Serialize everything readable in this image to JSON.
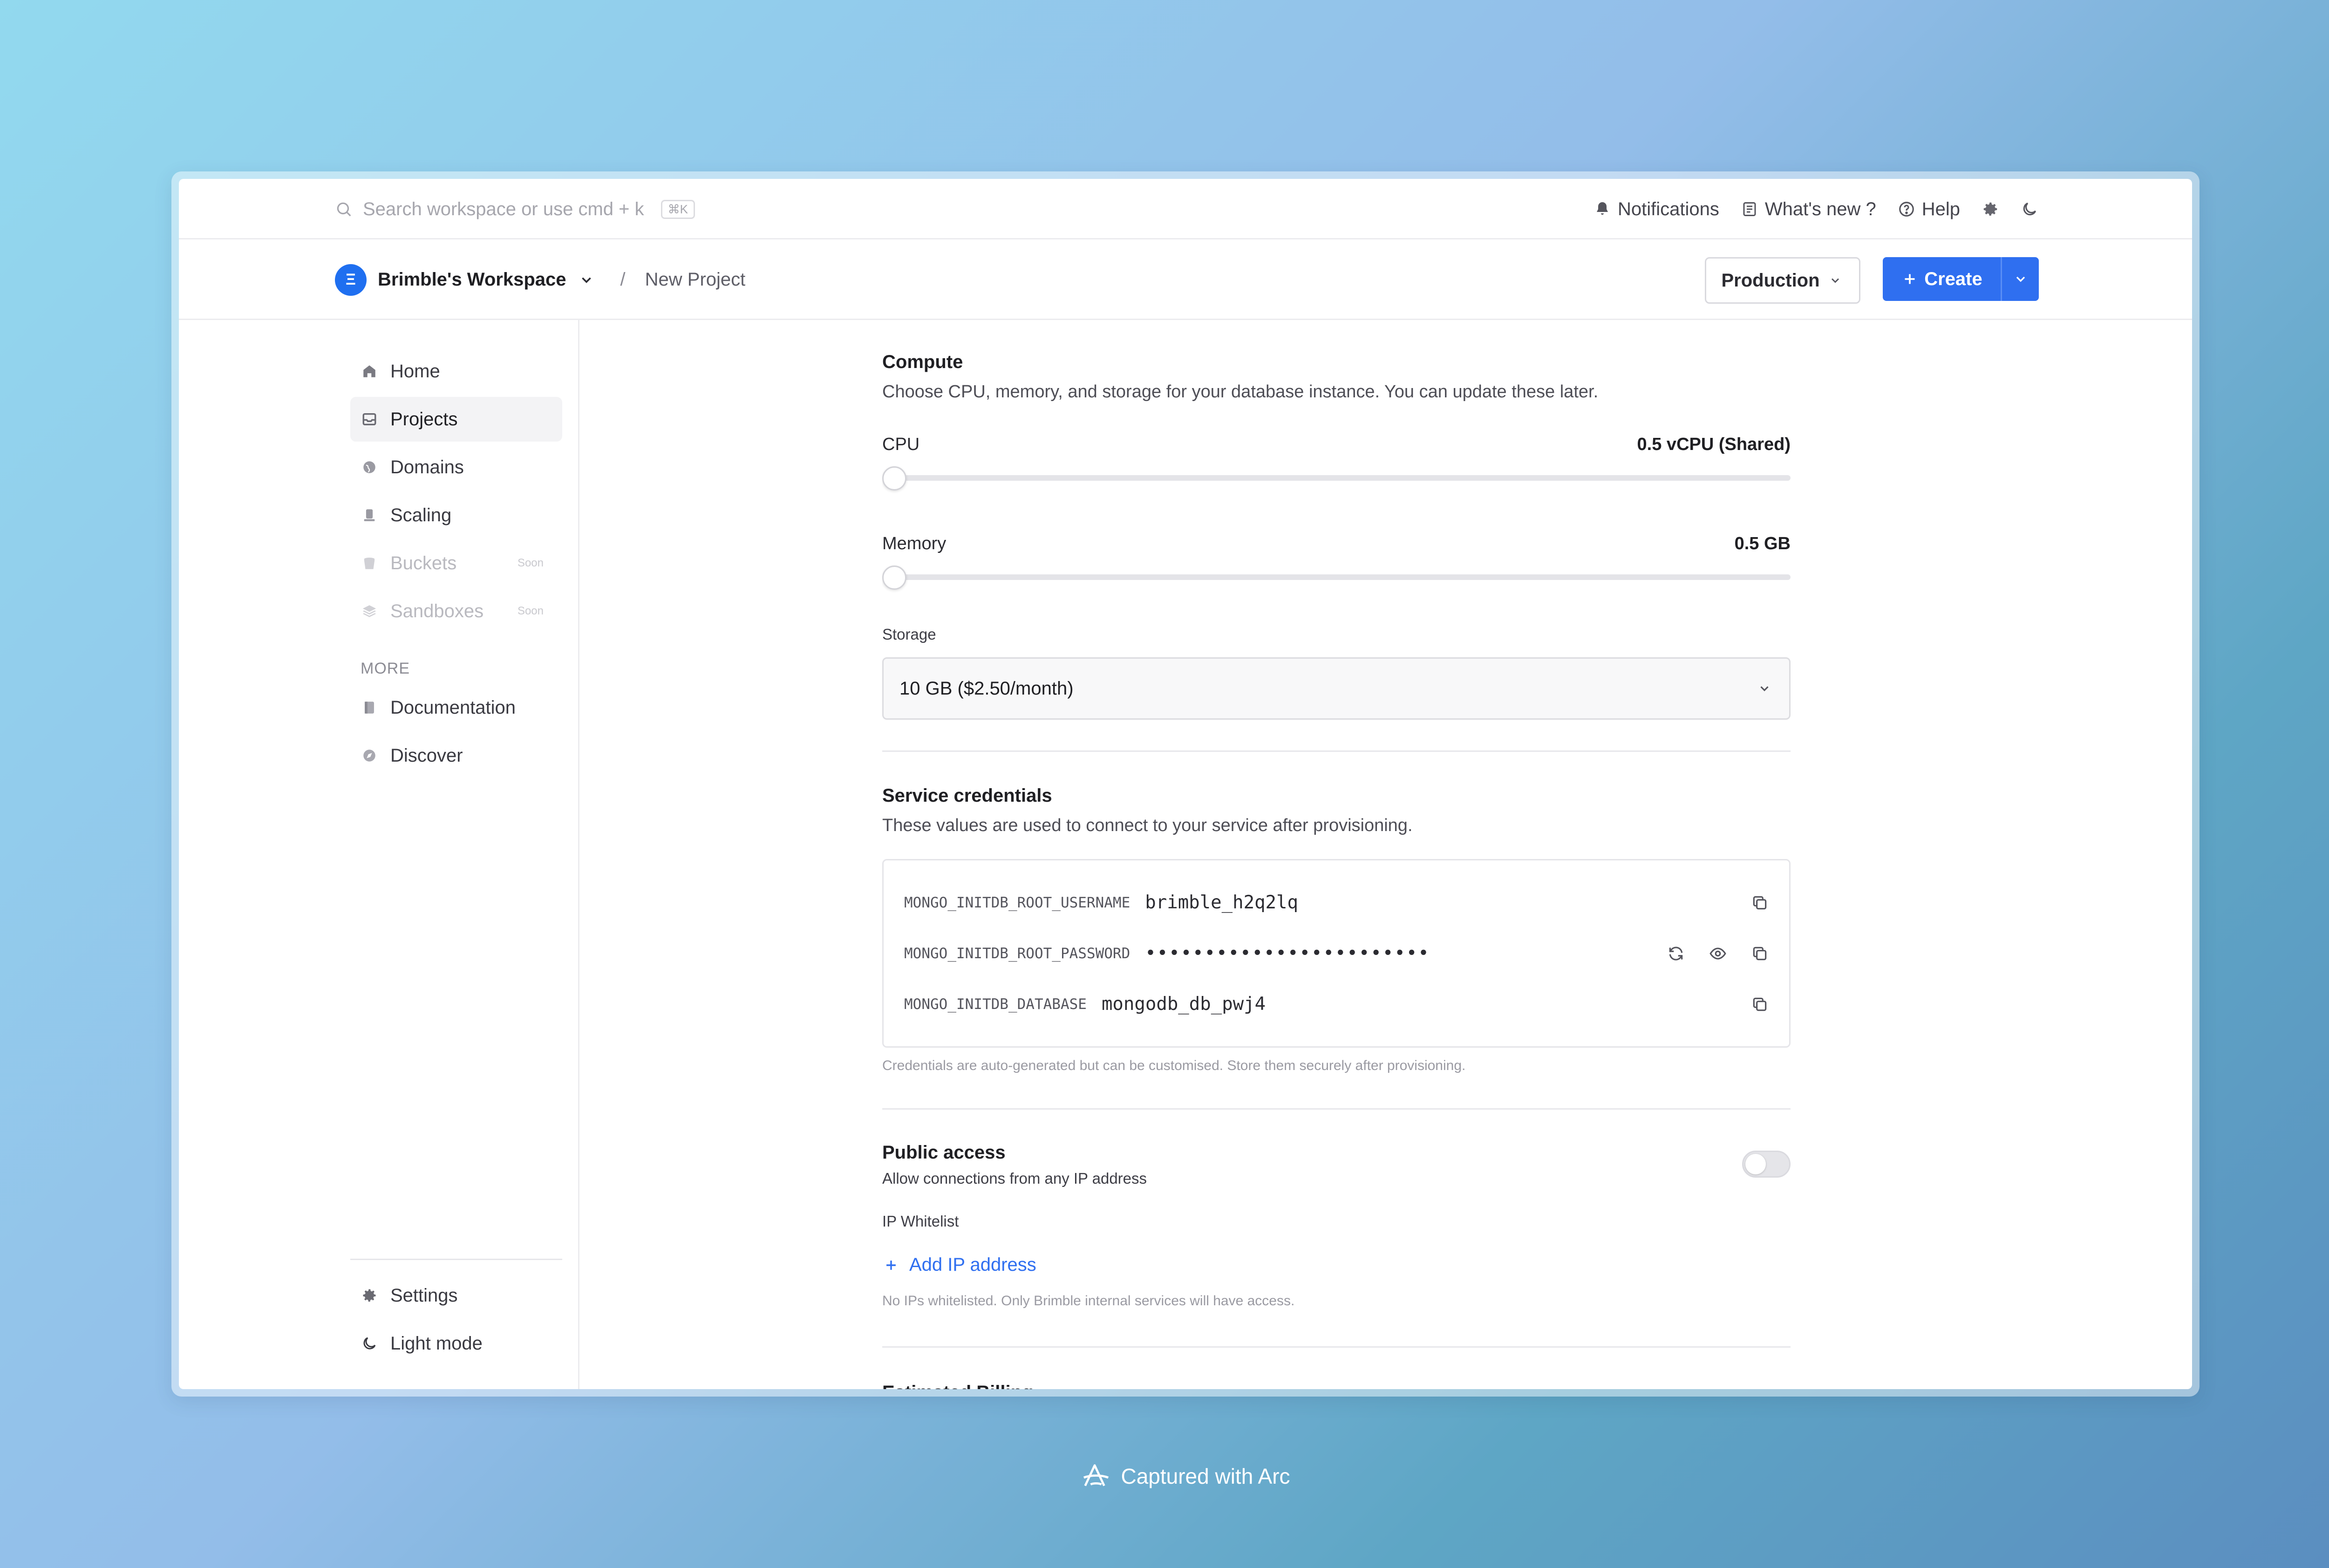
{
  "topbar": {
    "search_placeholder": "Search workspace or use cmd + k",
    "shortcut": "⌘K",
    "notifications": "Notifications",
    "whats_new": "What's new ?",
    "help": "Help"
  },
  "breadcrumb": {
    "workspace": "Brimble's Workspace",
    "workspace_initial": "Ξ",
    "separator": "/",
    "page": "New Project"
  },
  "actions": {
    "environment": "Production",
    "create": "Create"
  },
  "sidebar": {
    "items": [
      {
        "label": "Home",
        "icon": "home-icon"
      },
      {
        "label": "Projects",
        "icon": "inbox-icon",
        "active": true
      },
      {
        "label": "Domains",
        "icon": "globe-icon"
      },
      {
        "label": "Scaling",
        "icon": "scale-icon"
      },
      {
        "label": "Buckets",
        "icon": "bucket-icon",
        "badge": "Soon",
        "disabled": true
      },
      {
        "label": "Sandboxes",
        "icon": "layers-icon",
        "badge": "Soon",
        "disabled": true
      }
    ],
    "more_label": "MORE",
    "more_items": [
      {
        "label": "Documentation",
        "icon": "book-icon"
      },
      {
        "label": "Discover",
        "icon": "compass-icon"
      }
    ],
    "bottom_items": [
      {
        "label": "Settings",
        "icon": "gear-icon"
      },
      {
        "label": "Light mode",
        "icon": "moon-icon"
      }
    ]
  },
  "compute": {
    "title": "Compute",
    "description": "Choose CPU, memory, and storage for your database instance. You can update these later.",
    "cpu_label": "CPU",
    "cpu_value": "0.5 vCPU (Shared)",
    "cpu_level": 0,
    "memory_label": "Memory",
    "memory_value": "0.5 GB",
    "memory_level": 0,
    "storage_label": "Storage",
    "storage_value": "10 GB ($2.50/month)"
  },
  "credentials": {
    "title": "Service credentials",
    "description": "These values are used to connect to your service after provisioning.",
    "rows": [
      {
        "key": "MONGO_INITDB_ROOT_USERNAME",
        "value": "brimble_h2q2lq"
      },
      {
        "key": "MONGO_INITDB_ROOT_PASSWORD",
        "value": "••••••••••••••••••••••••"
      },
      {
        "key": "MONGO_INITDB_DATABASE",
        "value": "mongodb_db_pwj4"
      }
    ],
    "note": "Credentials are auto-generated but can be customised. Store them securely after provisioning."
  },
  "public_access": {
    "title": "Public access",
    "description": "Allow connections from any IP address",
    "enabled": false,
    "whitelist_label": "IP Whitelist",
    "add_ip": "Add IP address",
    "empty_note": "No IPs whitelisted. Only Brimble internal services will have access."
  },
  "billing": {
    "title": "Estimated Billing"
  },
  "footer": {
    "caption": "Captured with Arc"
  },
  "colors": {
    "accent": "#2f6ff0"
  }
}
